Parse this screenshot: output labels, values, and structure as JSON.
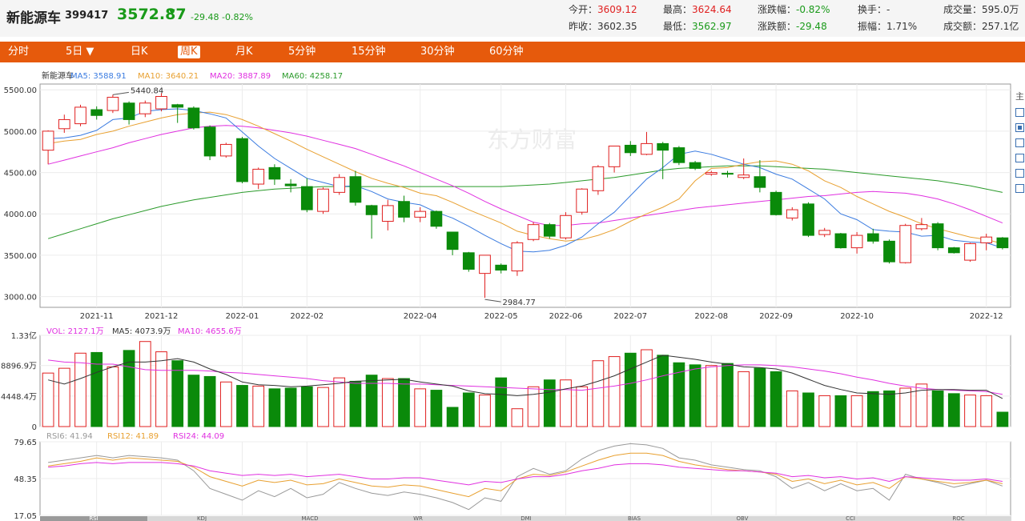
{
  "header": {
    "name": "新能源车",
    "code": "399417",
    "price": "3572.87",
    "change": "-29.48",
    "change_pct": "-0.82%",
    "stats": [
      {
        "label": "今开：",
        "value": "3609.12",
        "tone": "up"
      },
      {
        "label": "最高：",
        "value": "3624.64",
        "tone": "up"
      },
      {
        "label": "涨跌幅：",
        "value": "-0.82%",
        "tone": "dn"
      },
      {
        "label": "换手：",
        "value": "-",
        "tone": "nt"
      },
      {
        "label": "成交量：",
        "value": "595.0万",
        "tone": "nt"
      },
      {
        "label": "昨收：",
        "value": "3602.35",
        "tone": "nt"
      },
      {
        "label": "最低：",
        "value": "3562.97",
        "tone": "dn"
      },
      {
        "label": "涨跌额：",
        "value": "-29.48",
        "tone": "dn"
      },
      {
        "label": "振幅：",
        "value": "1.71%",
        "tone": "nt"
      },
      {
        "label": "成交额：",
        "value": "257.1亿",
        "tone": "nt"
      }
    ]
  },
  "toolbar": {
    "tabs": [
      "分时",
      "5日 ▼",
      "日K",
      "周K",
      "月K",
      "5分钟",
      "15分钟",
      "30分钟",
      "60分钟"
    ],
    "active_index": 3
  },
  "colors": {
    "up": "#e02020",
    "down": "#0a8a0a",
    "ma5": "#3a7be0",
    "ma10": "#e8a030",
    "ma20": "#e030e0",
    "ma60": "#2a9a2a",
    "accent": "#e65a0c"
  },
  "watermark": "东方财富",
  "side_label": "主",
  "side_boxes_checked": [
    false,
    true,
    false,
    false,
    false,
    false
  ],
  "indicator_tabs": [
    "RSI",
    "KDJ",
    "MACD",
    "WR",
    "DMI",
    "BIAS",
    "OBV",
    "CCI",
    "ROC"
  ],
  "chart_data": [
    {
      "type": "candlestick",
      "legend": [
        {
          "text": "新能源车",
          "color": "#333333"
        },
        {
          "text": "MA5: 3588.91",
          "color": "#3a7be0"
        },
        {
          "text": "MA10: 3640.21",
          "color": "#e8a030"
        },
        {
          "text": "MA20: 3887.89",
          "color": "#e030e0"
        },
        {
          "text": "MA60: 4258.17",
          "color": "#2a9a2a"
        }
      ],
      "ylim": [
        2870,
        5570
      ],
      "y_ticks": [
        "5500.00",
        "5000.00",
        "4500.00",
        "4000.00",
        "3500.00",
        "3000.00"
      ],
      "x_ticks": [
        {
          "label": "2021-11",
          "index": 3
        },
        {
          "label": "2021-12",
          "index": 7
        },
        {
          "label": "2022-01",
          "index": 12
        },
        {
          "label": "2022-02",
          "index": 16
        },
        {
          "label": "2022-04",
          "index": 23
        },
        {
          "label": "2022-05",
          "index": 28
        },
        {
          "label": "2022-06",
          "index": 32
        },
        {
          "label": "2022-07",
          "index": 36
        },
        {
          "label": "2022-08",
          "index": 41
        },
        {
          "label": "2022-09",
          "index": 45
        },
        {
          "label": "2022-10",
          "index": 50
        },
        {
          "label": "2022-12",
          "index": 58
        }
      ],
      "annotations": [
        {
          "text": "5440.84",
          "index": 4,
          "value": 5440.84
        },
        {
          "text": "2984.77",
          "index": 27,
          "value": 2984.77
        }
      ],
      "candles": [
        [
          4770,
          5000,
          4600,
          5010
        ],
        [
          5030,
          5140,
          4980,
          5200
        ],
        [
          5090,
          5290,
          5060,
          5320
        ],
        [
          5260,
          5190,
          5140,
          5300
        ],
        [
          5250,
          5410,
          5220,
          5440.84
        ],
        [
          5340,
          5140,
          5080,
          5360
        ],
        [
          5210,
          5340,
          5170,
          5370
        ],
        [
          5270,
          5420,
          5240,
          5460
        ],
        [
          5320,
          5290,
          5100,
          5330
        ],
        [
          5280,
          5040,
          5020,
          5300
        ],
        [
          5050,
          4700,
          4650,
          5070
        ],
        [
          4700,
          4840,
          4680,
          4860
        ],
        [
          4910,
          4390,
          4370,
          4930
        ],
        [
          4360,
          4540,
          4300,
          4560
        ],
        [
          4560,
          4420,
          4350,
          4600
        ],
        [
          4360,
          4340,
          4260,
          4420
        ],
        [
          4330,
          4050,
          4020,
          4430
        ],
        [
          4030,
          4300,
          4000,
          4320
        ],
        [
          4260,
          4440,
          4230,
          4480
        ],
        [
          4450,
          4140,
          4100,
          4520
        ],
        [
          4100,
          3990,
          3700,
          4110
        ],
        [
          3910,
          4100,
          3800,
          4170
        ],
        [
          4150,
          3960,
          3900,
          4220
        ],
        [
          3960,
          4030,
          3900,
          4080
        ],
        [
          4030,
          3850,
          3820,
          4040
        ],
        [
          3780,
          3570,
          3500,
          3780
        ],
        [
          3530,
          3330,
          3300,
          3540
        ],
        [
          3280,
          3500,
          2984.77,
          3500
        ],
        [
          3380,
          3320,
          3280,
          3400
        ],
        [
          3310,
          3650,
          3250,
          3670
        ],
        [
          3690,
          3870,
          3670,
          3900
        ],
        [
          3870,
          3730,
          3700,
          3890
        ],
        [
          3710,
          3980,
          3690,
          4020
        ],
        [
          4020,
          4300,
          3990,
          4310
        ],
        [
          4280,
          4570,
          4230,
          4590
        ],
        [
          4570,
          4820,
          4500,
          4820
        ],
        [
          4830,
          4740,
          4700,
          4880
        ],
        [
          4720,
          4850,
          4710,
          4990
        ],
        [
          4850,
          4770,
          4420,
          4870
        ],
        [
          4800,
          4620,
          4590,
          4820
        ],
        [
          4620,
          4550,
          4530,
          4640
        ],
        [
          4480,
          4500,
          4460,
          4520
        ],
        [
          4490,
          4480,
          4440,
          4520
        ],
        [
          4440,
          4470,
          4420,
          4670
        ],
        [
          4450,
          4320,
          4260,
          4650
        ],
        [
          4260,
          3990,
          3980,
          4280
        ],
        [
          3950,
          4050,
          3920,
          4080
        ],
        [
          4120,
          3740,
          3720,
          4140
        ],
        [
          3750,
          3800,
          3720,
          3830
        ],
        [
          3760,
          3590,
          3580,
          3770
        ],
        [
          3590,
          3740,
          3520,
          3780
        ],
        [
          3760,
          3670,
          3640,
          3820
        ],
        [
          3670,
          3420,
          3400,
          3690
        ],
        [
          3410,
          3860,
          3400,
          3880
        ],
        [
          3820,
          3870,
          3800,
          3950
        ],
        [
          3880,
          3590,
          3560,
          3900
        ],
        [
          3590,
          3530,
          3520,
          3600
        ],
        [
          3440,
          3640,
          3420,
          3650
        ],
        [
          3650,
          3720,
          3560,
          3760
        ],
        [
          3710,
          3590,
          3570,
          3720
        ]
      ],
      "ma5": [
        4910,
        4920,
        4950,
        5010,
        5140,
        5160,
        5240,
        5260,
        5270,
        5250,
        5210,
        5160,
        4990,
        4820,
        4670,
        4550,
        4430,
        4380,
        4330,
        4340,
        4270,
        4180,
        4140,
        4110,
        4020,
        3950,
        3850,
        3740,
        3640,
        3550,
        3540,
        3560,
        3620,
        3720,
        3880,
        4020,
        4220,
        4420,
        4560,
        4720,
        4760,
        4720,
        4660,
        4600,
        4560,
        4480,
        4420,
        4300,
        4180,
        4000,
        3930,
        3810,
        3790,
        3780,
        3730,
        3740,
        3680,
        3660,
        3650,
        3590
      ],
      "ma10": [
        4850,
        4880,
        4900,
        4960,
        5000,
        5060,
        5110,
        5160,
        5200,
        5220,
        5230,
        5200,
        5140,
        5060,
        4970,
        4880,
        4780,
        4690,
        4600,
        4510,
        4430,
        4370,
        4320,
        4250,
        4220,
        4140,
        4050,
        3970,
        3890,
        3790,
        3740,
        3700,
        3670,
        3690,
        3740,
        3810,
        3910,
        4000,
        4080,
        4180,
        4400,
        4550,
        4560,
        4600,
        4630,
        4640,
        4600,
        4520,
        4400,
        4320,
        4210,
        4120,
        4030,
        3960,
        3880,
        3820,
        3770,
        3720,
        3690,
        3640
      ],
      "ma20": [
        4600,
        4650,
        4700,
        4750,
        4800,
        4860,
        4910,
        4960,
        5000,
        5040,
        5060,
        5070,
        5060,
        5040,
        5010,
        4980,
        4940,
        4890,
        4840,
        4790,
        4720,
        4650,
        4580,
        4500,
        4420,
        4340,
        4250,
        4150,
        4060,
        3980,
        3900,
        3860,
        3860,
        3880,
        3890,
        3920,
        3950,
        3980,
        4010,
        4040,
        4070,
        4090,
        4110,
        4130,
        4150,
        4170,
        4190,
        4210,
        4220,
        4240,
        4260,
        4270,
        4260,
        4250,
        4220,
        4180,
        4120,
        4050,
        3970,
        3890
      ],
      "ma60": [
        3700,
        3760,
        3820,
        3880,
        3940,
        3990,
        4040,
        4090,
        4130,
        4170,
        4200,
        4230,
        4260,
        4280,
        4300,
        4310,
        4320,
        4330,
        4330,
        4330,
        4330,
        4330,
        4330,
        4330,
        4330,
        4330,
        4330,
        4330,
        4330,
        4340,
        4350,
        4360,
        4380,
        4400,
        4420,
        4440,
        4470,
        4500,
        4530,
        4550,
        4560,
        4570,
        4580,
        4580,
        4580,
        4570,
        4560,
        4550,
        4540,
        4520,
        4500,
        4480,
        4460,
        4440,
        4420,
        4400,
        4370,
        4340,
        4300,
        4260
      ]
    },
    {
      "type": "bar",
      "legend": [
        {
          "text": "VOL: 2127.1万",
          "color": "#e030e0"
        },
        {
          "text": "MA5: 4073.9万",
          "color": "#333333"
        },
        {
          "text": "MA10: 4655.6万",
          "color": "#e030e0"
        }
      ],
      "y_ticks": [
        "1.33亿",
        "8896.9万",
        "4448.4万",
        "0"
      ],
      "ylim": [
        0,
        13300
      ],
      "units": "万",
      "volume": [
        7800,
        8500,
        10700,
        10800,
        8700,
        11100,
        12400,
        10900,
        9600,
        7500,
        7300,
        6500,
        6000,
        5900,
        5500,
        5600,
        5800,
        5700,
        7100,
        6600,
        7500,
        7000,
        7000,
        5500,
        5300,
        2800,
        4900,
        4600,
        7100,
        2600,
        5800,
        6800,
        6800,
        5800,
        9600,
        10200,
        10700,
        11200,
        10400,
        9300,
        9000,
        8900,
        9200,
        8000,
        8500,
        8000,
        5200,
        4900,
        4500,
        4500,
        4500,
        5100,
        5200,
        5600,
        6200,
        5200,
        4800,
        4600,
        4500,
        2100
      ],
      "vol_ma5": [
        6800,
        6200,
        7000,
        7900,
        8700,
        9400,
        9400,
        9600,
        9900,
        9400,
        8400,
        7600,
        6500,
        6100,
        6000,
        5800,
        5900,
        6100,
        6300,
        6600,
        6700,
        6800,
        6900,
        6500,
        6200,
        5900,
        5200,
        4800,
        4700,
        4500,
        4700,
        5000,
        5500,
        5900,
        6600,
        7400,
        8400,
        9400,
        10400,
        10100,
        9800,
        9400,
        9100,
        8700,
        8600,
        8400,
        7800,
        6900,
        6000,
        5400,
        4900,
        4800,
        4700,
        4900,
        5300,
        5400,
        5400,
        5300,
        5300,
        4100
      ],
      "vol_ma10": [
        9700,
        9400,
        9300,
        9100,
        9100,
        8700,
        8300,
        8200,
        8200,
        8200,
        8100,
        7900,
        7800,
        7600,
        7400,
        7200,
        7000,
        6700,
        6500,
        6300,
        6300,
        6300,
        6200,
        6200,
        6100,
        6000,
        5900,
        5800,
        5700,
        5600,
        5500,
        5400,
        5400,
        5300,
        5600,
        5900,
        6300,
        6800,
        7400,
        7900,
        8400,
        8700,
        8900,
        9000,
        9000,
        8900,
        8700,
        8400,
        8100,
        7700,
        7200,
        6800,
        6300,
        5900,
        5600,
        5400,
        5300,
        5200,
        5100,
        4700
      ]
    },
    {
      "type": "line",
      "legend": [
        {
          "text": "RSI6: 41.94",
          "color": "#999999"
        },
        {
          "text": "RSI12: 41.89",
          "color": "#e8a030"
        },
        {
          "text": "RSI24: 44.09",
          "color": "#e030e0"
        }
      ],
      "y_ticks": [
        "79.65",
        "48.35",
        "17.05"
      ],
      "ylim": [
        17.05,
        79.65
      ],
      "rsi6": [
        62,
        64,
        66,
        68,
        66,
        68,
        67,
        66,
        64,
        55,
        40,
        35,
        30,
        38,
        33,
        40,
        32,
        35,
        45,
        40,
        36,
        34,
        37,
        35,
        32,
        28,
        22,
        32,
        29,
        50,
        57,
        52,
        55,
        65,
        72,
        76,
        78,
        77,
        74,
        66,
        64,
        60,
        58,
        56,
        55,
        50,
        40,
        45,
        38,
        44,
        38,
        40,
        30,
        52,
        48,
        45,
        41,
        44,
        47,
        42
      ],
      "rsi12": [
        59,
        61,
        63,
        66,
        64,
        66,
        65,
        64,
        63,
        58,
        50,
        46,
        42,
        47,
        45,
        47,
        43,
        44,
        48,
        45,
        42,
        41,
        43,
        42,
        39,
        36,
        33,
        40,
        38,
        48,
        52,
        51,
        54,
        59,
        64,
        68,
        70,
        70,
        68,
        63,
        60,
        58,
        56,
        55,
        54,
        52,
        46,
        48,
        44,
        47,
        43,
        45,
        40,
        50,
        48,
        46,
        44,
        45,
        47,
        44
      ],
      "rsi24": [
        58,
        59,
        61,
        62,
        61,
        62,
        62,
        62,
        61,
        59,
        55,
        53,
        51,
        52,
        51,
        52,
        50,
        51,
        52,
        50,
        48,
        48,
        49,
        49,
        47,
        45,
        43,
        46,
        45,
        48,
        50,
        50,
        52,
        55,
        57,
        60,
        61,
        61,
        60,
        58,
        57,
        56,
        55,
        55,
        54,
        53,
        50,
        51,
        49,
        50,
        48,
        49,
        46,
        50,
        49,
        48,
        47,
        47,
        48,
        46
      ]
    }
  ]
}
